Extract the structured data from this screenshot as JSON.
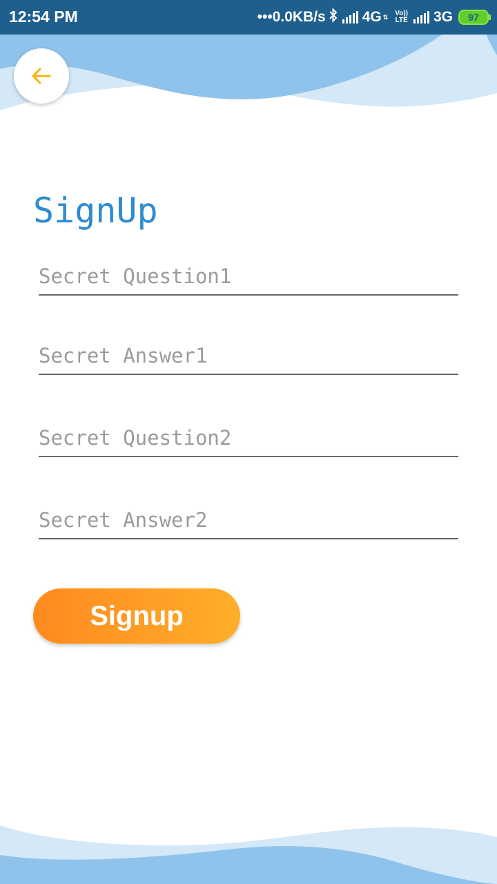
{
  "status_bar": {
    "time": "12:54 PM",
    "speed": "•••0.0KB/s",
    "network1": "4G",
    "volte_top": "Vo))",
    "volte_bottom": "LTE",
    "network2": "3G",
    "battery": "97",
    "icons": [
      "bluetooth-icon",
      "signal-icon",
      "signal-icon",
      "battery-icon"
    ]
  },
  "back_icon": "arrow-left-icon",
  "title": "SignUp",
  "form": {
    "question1_placeholder": "Secret Question1",
    "answer1_placeholder": "Secret Answer1",
    "question2_placeholder": "Secret Question2",
    "answer2_placeholder": "Secret Answer2"
  },
  "signup_label": "Signup",
  "colors": {
    "status_bar": "#1f5f8e",
    "title": "#2d8bd0",
    "button_start": "#ff8a1f",
    "button_end": "#ffae2a",
    "back_arrow": "#f5b400",
    "wave_light": "#d4e8f8",
    "wave_dark": "#8fc3eb"
  }
}
